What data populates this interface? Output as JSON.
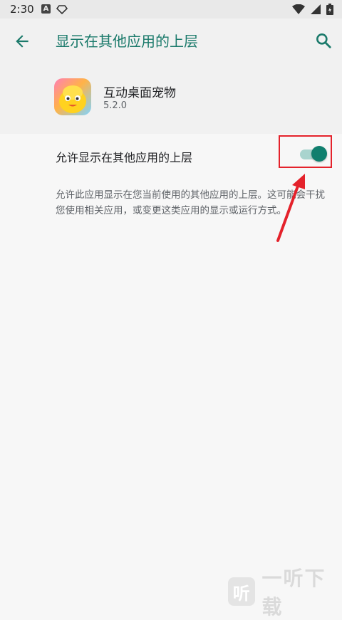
{
  "status_bar": {
    "time": "2:30",
    "icons": [
      "a-badge-icon",
      "diamond-icon",
      "wifi-icon",
      "signal-icon",
      "battery-icon"
    ]
  },
  "header": {
    "title": "显示在其他应用的上层",
    "back_icon": "back-arrow-icon",
    "search_icon": "search-icon"
  },
  "app": {
    "name": "互动桌面宠物",
    "version": "5.2.0"
  },
  "setting": {
    "label": "允许显示在其他应用的上层",
    "enabled": true,
    "description": "允许此应用显示在您当前使用的其他应用的上层。这可能会干扰您使用相关应用，或变更这类应用的显示或运行方式。"
  },
  "watermark": {
    "badge": "听",
    "text": "一听下载"
  },
  "colors": {
    "accent": "#1b7a6b",
    "switch_thumb": "#107f6e",
    "switch_track": "#a9d4ce",
    "annotation": "#e4222b"
  }
}
